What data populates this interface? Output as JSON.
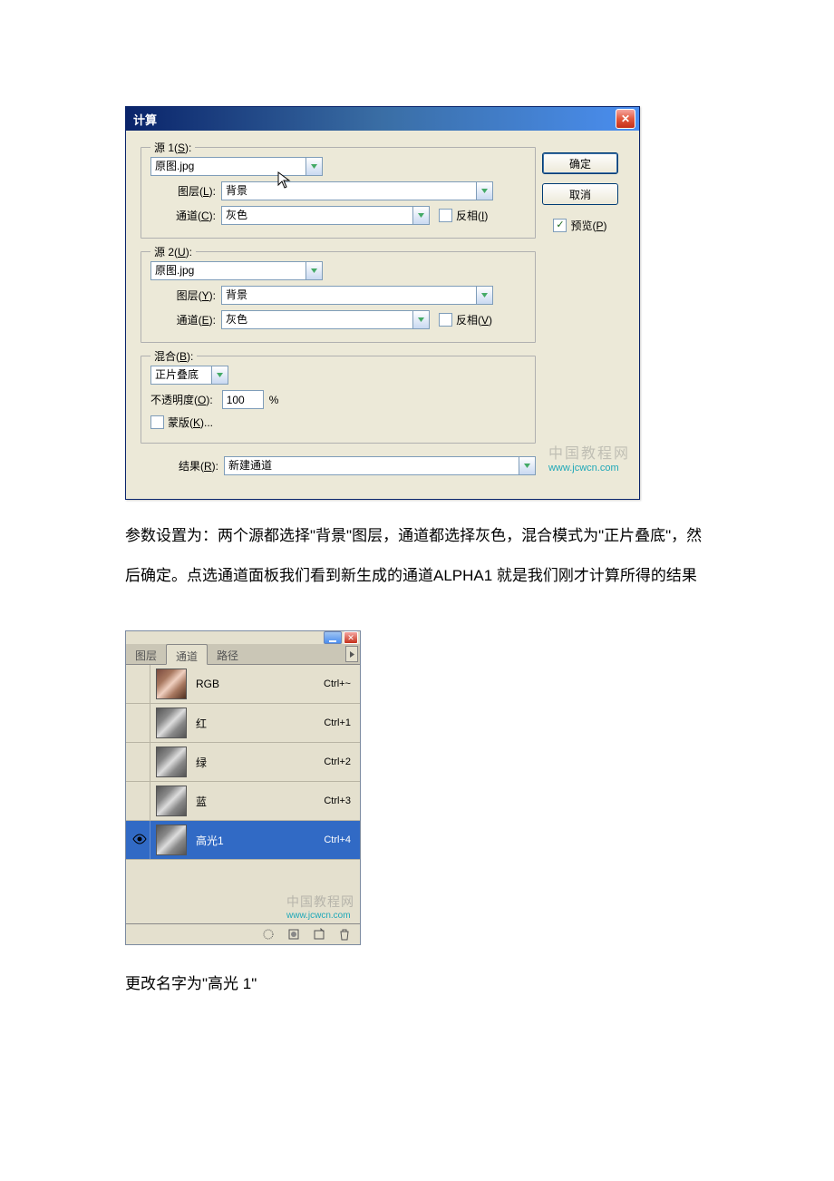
{
  "dialog": {
    "title": "计算",
    "source1": {
      "legend_pre": "源 1(",
      "legend_u": "S",
      "legend_post": "):",
      "value": "原图.jpg",
      "layer_label_pre": "图层(",
      "layer_label_u": "L",
      "layer_label_post": "):",
      "layer_value": "背景",
      "channel_label_pre": "通道(",
      "channel_label_u": "C",
      "channel_label_post": "):",
      "channel_value": "灰色",
      "invert_pre": "反相(",
      "invert_u": "I",
      "invert_post": ")",
      "invert_checked": false
    },
    "source2": {
      "legend_pre": "源 2(",
      "legend_u": "U",
      "legend_post": "):",
      "value": "原图.jpg",
      "layer_label_pre": "图层(",
      "layer_label_u": "Y",
      "layer_label_post": "):",
      "layer_value": "背景",
      "channel_label_pre": "通道(",
      "channel_label_u": "E",
      "channel_label_post": "):",
      "channel_value": "灰色",
      "invert_pre": "反相(",
      "invert_u": "V",
      "invert_post": ")",
      "invert_checked": false
    },
    "blending": {
      "label_pre": "混合(",
      "label_u": "B",
      "label_post": "):",
      "value": "正片叠底",
      "opacity_label_pre": "不透明度(",
      "opacity_label_u": "O",
      "opacity_label_post": "):",
      "opacity_value": "100",
      "opacity_unit": "%",
      "mask_pre": "蒙版(",
      "mask_u": "K",
      "mask_post": ")...",
      "mask_checked": false
    },
    "result": {
      "label_pre": "结果(",
      "label_u": "R",
      "label_post": "):",
      "value": "新建通道"
    },
    "buttons": {
      "ok": "确定",
      "cancel": "取消",
      "preview_pre": "预览(",
      "preview_u": "P",
      "preview_post": ")",
      "preview_checked": true
    },
    "watermark": {
      "text": "中国教程网",
      "url": "www.jcwcn.com"
    }
  },
  "paragraph1": "参数设置为：两个源都选择\"背景\"图层，通道都选择灰色，混合模式为\"正片叠底\"，然后确定。点选通道面板我们看到新生成的通道ALPHA1 就是我们刚才计算所得的结果",
  "panel": {
    "tabs": {
      "layers": "图层",
      "channels": "通道",
      "paths": "路径"
    },
    "rows": [
      {
        "name": "RGB",
        "shortcut": "Ctrl+~",
        "visible": false,
        "selected": false,
        "color": true
      },
      {
        "name": "红",
        "shortcut": "Ctrl+1",
        "visible": false,
        "selected": false,
        "color": false
      },
      {
        "name": "绿",
        "shortcut": "Ctrl+2",
        "visible": false,
        "selected": false,
        "color": false
      },
      {
        "name": "蓝",
        "shortcut": "Ctrl+3",
        "visible": false,
        "selected": false,
        "color": false
      },
      {
        "name": "高光1",
        "shortcut": "Ctrl+4",
        "visible": true,
        "selected": true,
        "color": false
      }
    ],
    "watermark": {
      "text": "中国教程网",
      "url": "www.jcwcn.com"
    }
  },
  "paragraph2": "更改名字为\"高光 1\""
}
